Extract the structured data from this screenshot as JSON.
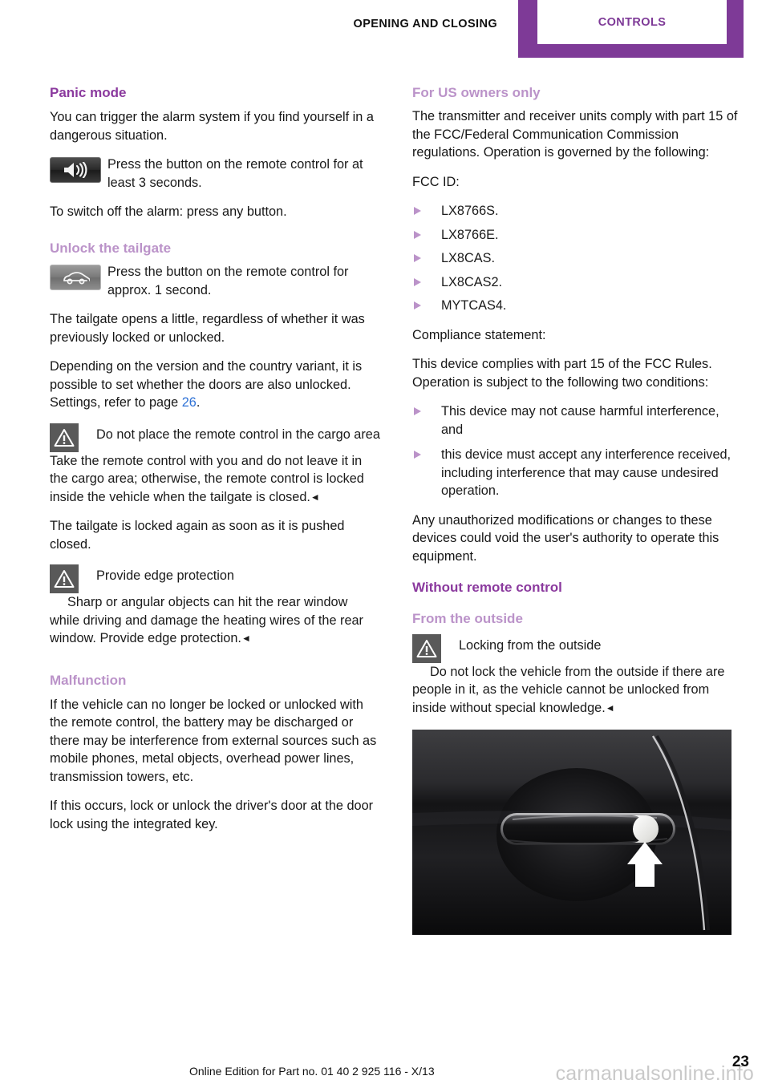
{
  "header": {
    "chapter": "OPENING AND CLOSING",
    "tab": "CONTROLS"
  },
  "left_column": {
    "panic": {
      "title": "Panic mode",
      "intro": "You can trigger the alarm system if you find yourself in a dangerous situation.",
      "button_icon": "speaker-alarm-icon",
      "button_text": "Press the button on the remote control for at least 3 seconds.",
      "switch_off": "To switch off the alarm: press any button."
    },
    "tailgate": {
      "title": "Unlock the tailgate",
      "button_icon": "car-tailgate-icon",
      "button_text": "Press the button on the remote control for approx. 1 second.",
      "para1": "The tailgate opens a little, regardless of whether it was previously locked or unlocked.",
      "para2_before": "Depending on the version and the country variant, it is possible to set whether the doors are also unlocked. Settings, refer to page ",
      "para2_link": "26",
      "para2_after": ".",
      "warning1_title": "Do not place the remote control in the cargo area",
      "warning1_body": "Take the remote control with you and do not leave it in the cargo area; otherwise, the remote control is locked inside the vehicle when the tailgate is closed.",
      "para3": "The tailgate is locked again as soon as it is pushed closed.",
      "warning2_title": "Provide edge protection",
      "warning2_body": "Sharp or angular objects can hit the rear window while driving and damage the heating wires of the rear window. Provide edge protection."
    },
    "malfunction": {
      "title": "Malfunction",
      "para1": "If the vehicle can no longer be locked or unlocked with the remote control, the battery may be discharged or there may be interference from external sources such as mobile phones, metal objects, overhead power lines, transmission towers, etc.",
      "para2": "If this occurs, lock or unlock the driver's door at the door lock using the integrated key."
    }
  },
  "right_column": {
    "us_owners": {
      "title": "For US owners only",
      "intro": "The transmitter and receiver units comply with part 15 of the FCC/Federal Communication Commission regulations. Operation is governed by the following:",
      "fcc_id_label": "FCC ID:",
      "fcc_ids": [
        "LX8766S.",
        "LX8766E.",
        "LX8CAS.",
        "LX8CAS2.",
        "MYTCAS4."
      ],
      "compliance_label": "Compliance statement:",
      "compliance_intro": "This device complies with part 15 of the FCC Rules. Operation is subject to the following two conditions:",
      "conditions": [
        "This device may not cause harmful interference, and",
        "this device must accept any interference received, including interference that may cause undesired operation."
      ],
      "closing": "Any unauthorized modifications or changes to these devices could void the user's authority to operate this equipment."
    },
    "without_remote": {
      "title": "Without remote control",
      "outside_title": "From the outside",
      "warning_title": "Locking from the outside",
      "warning_body": "Do not lock the vehicle from the outside if there are people in it, as the vehicle cannot be unlocked from inside without special knowledge.",
      "photo_caption": "car-door-handle-lock-photo"
    }
  },
  "footer": {
    "edition": "Online Edition for Part no. 01 40 2 925 116 - X/13",
    "page_number": "23",
    "watermark": "carmanualsonline.info"
  },
  "symbols": {
    "end_mark": "◄"
  },
  "colors": {
    "brand_purple": "#7e3a97",
    "heading_purple": "#8b3a9e",
    "subheading_purple": "#bb93c9",
    "link_blue": "#2f72d6",
    "warn_box_grey": "#595959"
  }
}
